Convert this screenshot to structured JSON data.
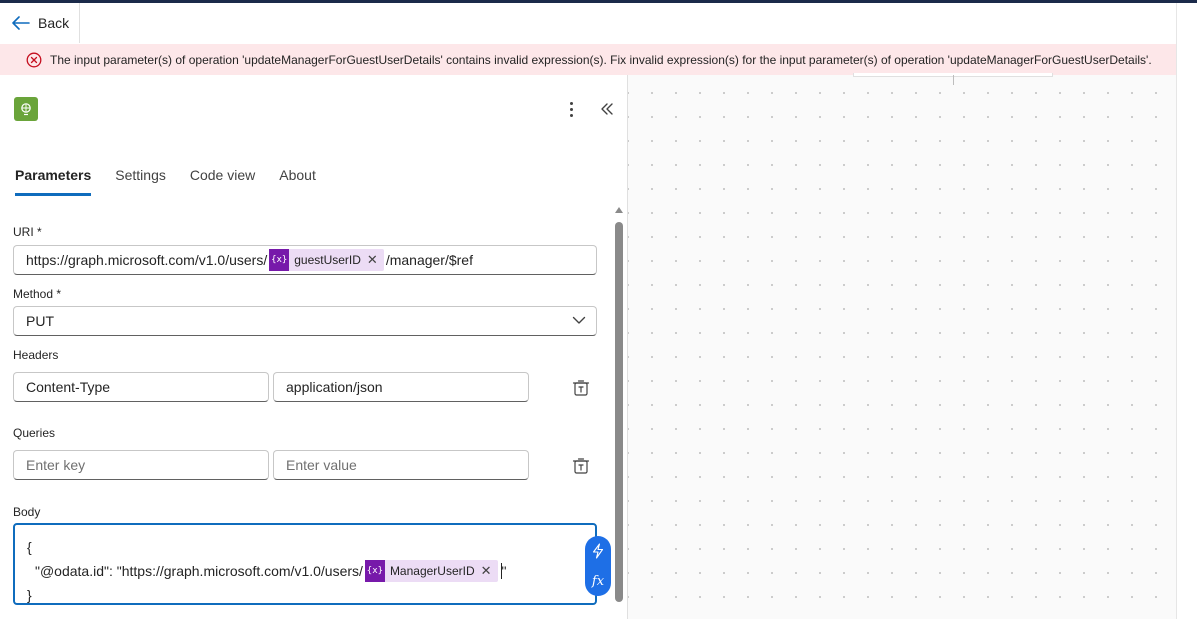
{
  "header": {
    "back_label": "Back"
  },
  "error": {
    "message": "The input parameter(s) of operation 'updateManagerForGuestUserDetails' contains invalid expression(s). Fix invalid expression(s) for the input parameter(s) of operation 'updateManagerForGuestUserDetails'."
  },
  "panel": {
    "tabs": [
      "Parameters",
      "Settings",
      "Code view",
      "About"
    ],
    "active_tab": "Parameters",
    "uri": {
      "label": "URI *",
      "prefix": "https://graph.microsoft.com/v1.0/users/",
      "token_icon": "{x}",
      "token_label": "guestUserID",
      "suffix": "/manager/$ref"
    },
    "method": {
      "label": "Method *",
      "value": "PUT"
    },
    "headers": {
      "label": "Headers",
      "key": "Content-Type",
      "value": "application/json"
    },
    "queries": {
      "label": "Queries",
      "key_placeholder": "Enter key",
      "value_placeholder": "Enter value"
    },
    "body": {
      "label": "Body",
      "line1": "{",
      "line2_prefix": "\"@odata.id\": \"https://graph.microsoft.com/v1.0/users/",
      "token_icon": "{x}",
      "token_label": "ManagerUserID",
      "line2_suffix": "\"",
      "line3": "}"
    },
    "fx_label": "fx"
  },
  "colors": {
    "accent": "#0f6cbd",
    "error_bg": "#fde7e9",
    "error_icon": "#c50f1f",
    "token_bg": "#ecdcf5",
    "token_icon_bg": "#7719aa",
    "op_icon_bg": "#6aa43a"
  },
  "icons": {
    "back": "arrow-left-icon",
    "error": "error-circle-icon",
    "more": "more-vertical-icon",
    "collapse": "double-chevron-left-icon",
    "dropdown": "chevron-down-icon",
    "delete": "delete-icon",
    "lightning": "lightning-icon"
  }
}
